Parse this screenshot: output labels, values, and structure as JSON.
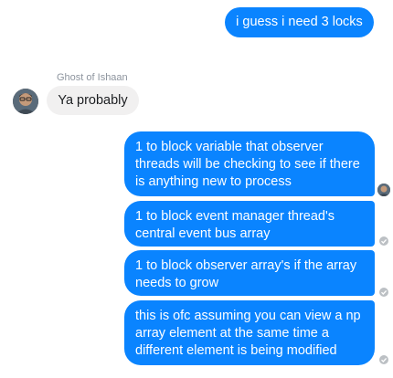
{
  "thread": {
    "messages": [
      {
        "direction": "outgoing",
        "text": "i guess i need 3 locks"
      },
      {
        "direction": "incoming",
        "sender": "Ghost of Ishaan",
        "text": "Ya probably"
      },
      {
        "direction": "outgoing",
        "text": "1 to block variable that observer threads will be checking to see if there is anything new to process"
      },
      {
        "direction": "outgoing",
        "text": "1 to block event manager thread's central event bus array"
      },
      {
        "direction": "outgoing",
        "text": "1 to block observer array's if the array needs to grow"
      },
      {
        "direction": "outgoing",
        "text": "this is ofc assuming you can view a np array element at the same time a different element is being modified"
      }
    ]
  },
  "colors": {
    "outgoing_bubble": "#0a84ff",
    "incoming_bubble": "#f1f0f0",
    "delivered_icon": "#bcc0c4"
  },
  "icons": {
    "avatar": "user-avatar-photo",
    "seen_avatar": "seen-avatar-icon",
    "delivered": "check-circle-icon"
  }
}
